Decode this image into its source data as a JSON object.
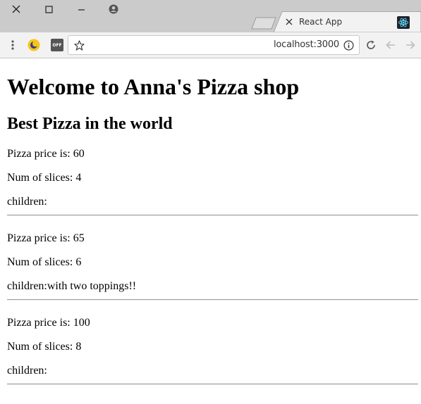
{
  "browser": {
    "tab_title": "React App",
    "url": "localhost:3000",
    "extensions": {
      "off_badge": "OFF"
    }
  },
  "page": {
    "heading": "Welcome to Anna's Pizza shop",
    "subheading": "Best Pizza in the world",
    "price_label": "Pizza price is: ",
    "slices_label": "Num of slices: ",
    "children_label": "children:",
    "pizzas": [
      {
        "price": "60",
        "slices": "4",
        "children": ""
      },
      {
        "price": "65",
        "slices": "6",
        "children": "with two toppings!!"
      },
      {
        "price": "100",
        "slices": "8",
        "children": ""
      }
    ]
  }
}
